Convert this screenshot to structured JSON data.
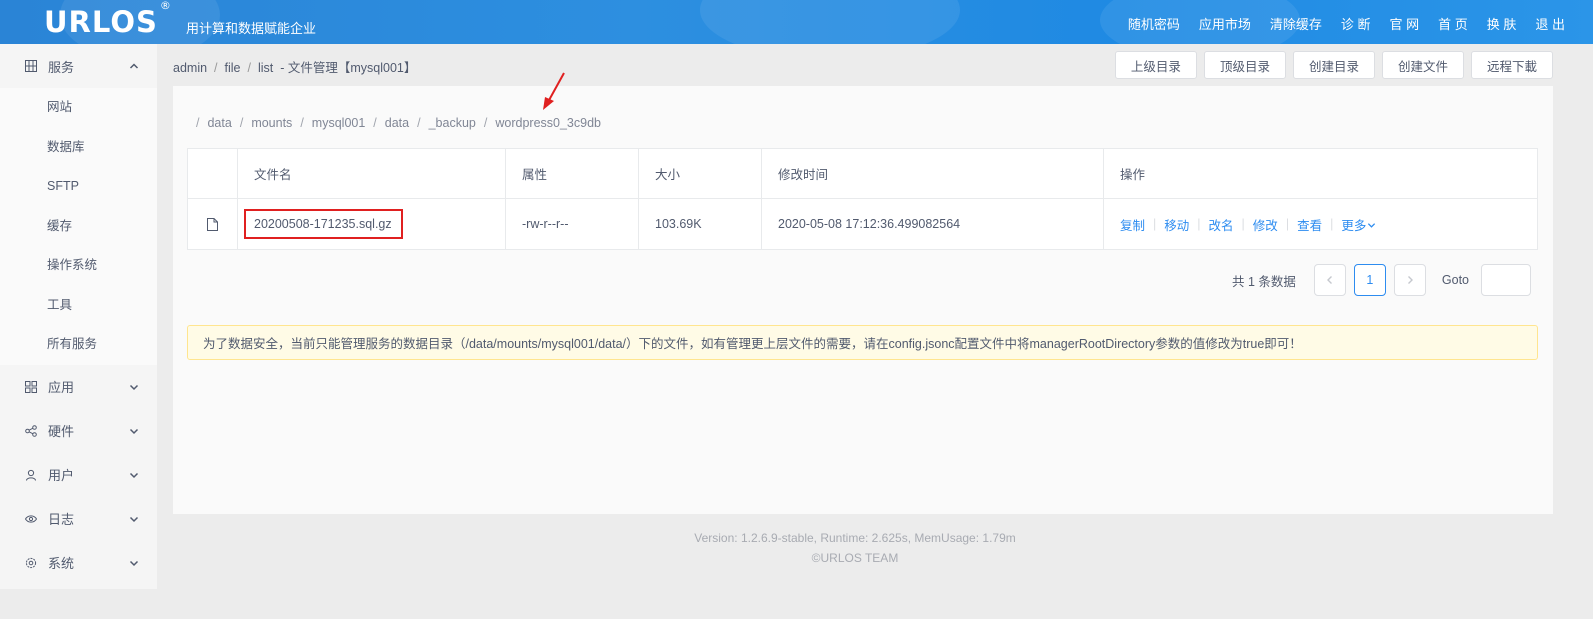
{
  "header": {
    "logo": "URLOS",
    "logo_mark": "®",
    "slogan": "用计算和数据赋能企业",
    "nav": [
      "随机密码",
      "应用市场",
      "清除缓存",
      "诊 断",
      "官 网",
      "首 页",
      "换 肤",
      "退 出"
    ]
  },
  "sidebar": {
    "services": {
      "label": "服务",
      "icon": "grid-box-icon",
      "items": [
        "网站",
        "数据库",
        "SFTP",
        "缓存",
        "操作系统",
        "工具",
        "所有服务"
      ]
    },
    "groups": [
      {
        "label": "应用",
        "icon": "apps-icon"
      },
      {
        "label": "硬件",
        "icon": "share-icon"
      },
      {
        "label": "用户",
        "icon": "user-icon"
      },
      {
        "label": "日志",
        "icon": "eye-icon"
      },
      {
        "label": "系统",
        "icon": "gear-icon"
      }
    ]
  },
  "breadcrumb": {
    "items": [
      "admin",
      "file",
      "list"
    ],
    "title": "文件管理【mysql001】"
  },
  "toolbar": [
    "上级目录",
    "顶级目录",
    "创建目录",
    "创建文件",
    "远程下載"
  ],
  "path": [
    "data",
    "mounts",
    "mysql001",
    "data",
    "_backup",
    "wordpress0_3c9db"
  ],
  "table": {
    "headers": [
      "文件名",
      "属性",
      "大小",
      "修改时间",
      "操作"
    ],
    "rows": [
      {
        "icon": "file-icon",
        "name": "20200508-171235.sql.gz",
        "attr": "-rw-r--r--",
        "size": "103.69K",
        "mtime": "2020-05-08 17:12:36.499082564",
        "ops": [
          "复制",
          "移动",
          "改名",
          "修改",
          "查看"
        ],
        "more": "更多"
      }
    ]
  },
  "pager": {
    "total": "共 1 条数据",
    "current": "1",
    "goto": "Goto"
  },
  "notice": "为了数据安全，当前只能管理服务的数据目录（/data/mounts/mysql001/data/）下的文件，如有管理更上层文件的需要，请在config.jsonc配置文件中将managerRootDirectory参数的值修改为true即可！",
  "footer": {
    "line1": "Version: 1.2.6.9-stable,    Runtime: 2.625s,    MemUsage: 1.79m",
    "line2": "©URLOS TEAM"
  },
  "colors": {
    "header": "#2d8fe0",
    "link": "#2d8cf0",
    "highlight": "#e02020",
    "notice_bg": "#fffbe6"
  }
}
